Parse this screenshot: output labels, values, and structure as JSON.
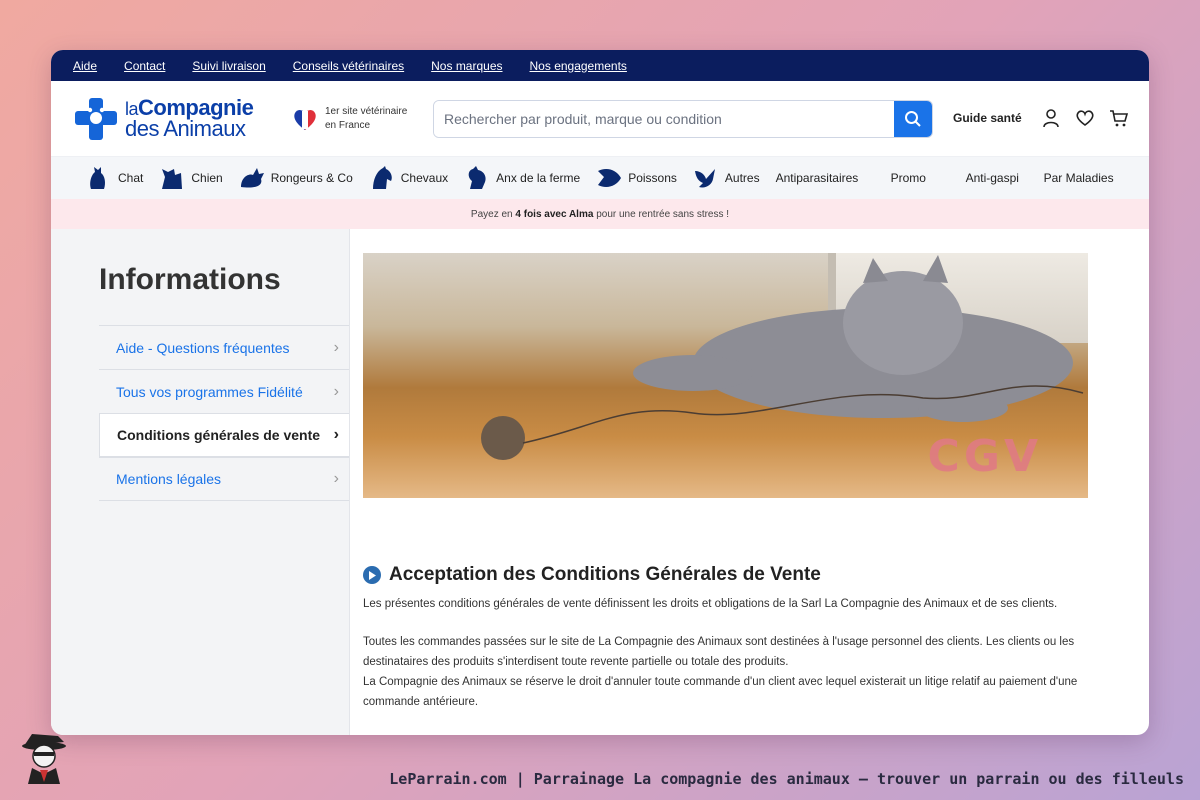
{
  "utility_links": [
    "Aide",
    "Contact",
    "Suivi livraison",
    "Conseils vétérinaires",
    "Nos marques",
    "Nos engagements"
  ],
  "brand": {
    "line1a": "la",
    "line1b": "Compagnie",
    "line2": "des Animaux"
  },
  "vet_badge": {
    "line1": "1er site vétérinaire",
    "line2": "en France"
  },
  "search": {
    "placeholder": "Rechercher par produit, marque ou condition"
  },
  "guide_label": "Guide santé",
  "categories": [
    {
      "label": "Chat",
      "icon": "cat-icon"
    },
    {
      "label": "Chien",
      "icon": "dog-icon"
    },
    {
      "label": "Rongeurs & Co",
      "icon": "rodent-icon"
    },
    {
      "label": "Chevaux",
      "icon": "horse-icon"
    },
    {
      "label": "Anx de la ferme",
      "icon": "rooster-icon"
    },
    {
      "label": "Poissons",
      "icon": "fish-icon"
    },
    {
      "label": "Autres",
      "icon": "bird-icon"
    }
  ],
  "text_nav": [
    "Antiparasitaires",
    "Promo",
    "Anti-gaspi",
    "Par Maladies"
  ],
  "promo": {
    "pre": "Payez en ",
    "bold": "4 fois avec Alma",
    "post": " pour une rentrée sans stress !"
  },
  "sidebar": {
    "title": "Informations",
    "items": [
      {
        "label": "Aide - Questions fréquentes",
        "active": false
      },
      {
        "label": "Tous vos programmes Fidélité",
        "active": false
      },
      {
        "label": "Conditions générales de vente",
        "active": true
      },
      {
        "label": "Mentions légales",
        "active": false
      }
    ]
  },
  "banner_text": "CGV",
  "section": {
    "title": "Acceptation des Conditions Générales de Vente",
    "p1": "Les présentes conditions générales de vente définissent les droits et obligations de la Sarl La Compagnie des Animaux et de ses clients.",
    "p2": "Toutes les commandes passées sur le site de La Compagnie des Animaux sont destinées à l'usage personnel des clients. Les clients ou les destinataires des produits s'interdisent toute revente partielle ou totale des produits.",
    "p3": "La Compagnie des Animaux se réserve le droit d'annuler toute commande d'un client avec lequel existerait un litige relatif au paiement d'une commande antérieure."
  },
  "footer_caption": "LeParrain.com | Parrainage La compagnie des animaux — trouver un parrain ou des filleuls"
}
